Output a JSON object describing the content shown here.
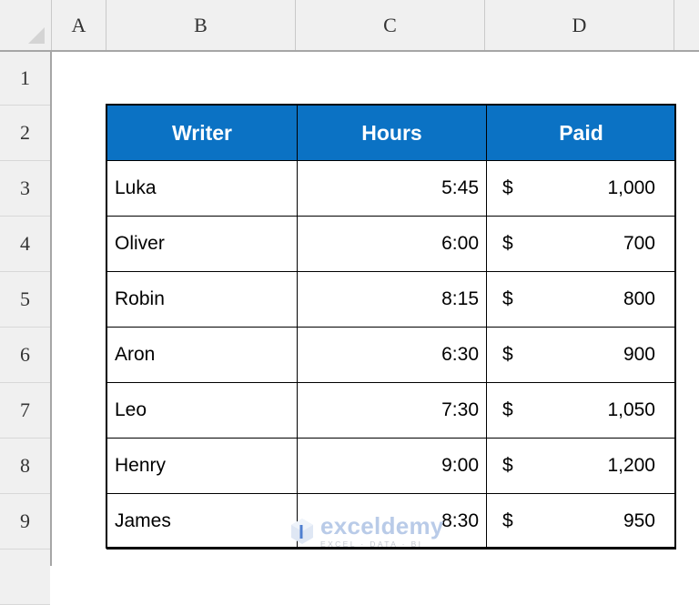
{
  "app": {
    "type": "spreadsheet",
    "accent_color": "#0B72C4",
    "header_text_color": "#FFFFFF",
    "grid_background": "#FFFFFF",
    "gutter_background": "#F0F0F0",
    "border_color": "#000000"
  },
  "grid": {
    "column_headers": [
      "A",
      "B",
      "C",
      "D"
    ],
    "row_headers": [
      "1",
      "2",
      "3",
      "4",
      "5",
      "6",
      "7",
      "8",
      "9"
    ],
    "select_all_corner": "select-all-triangle"
  },
  "table": {
    "columns": [
      {
        "key": "writer",
        "label": "Writer",
        "align": "left"
      },
      {
        "key": "hours",
        "label": "Hours",
        "align": "right"
      },
      {
        "key": "paid",
        "label": "Paid",
        "align": "right"
      }
    ],
    "rows": [
      {
        "writer": "Luka",
        "hours": "5:45",
        "paid_symbol": "$",
        "paid_amount": "1,000"
      },
      {
        "writer": "Oliver",
        "hours": "6:00",
        "paid_symbol": "$",
        "paid_amount": "700"
      },
      {
        "writer": "Robin",
        "hours": "8:15",
        "paid_symbol": "$",
        "paid_amount": "800"
      },
      {
        "writer": "Aron",
        "hours": "6:30",
        "paid_symbol": "$",
        "paid_amount": "900"
      },
      {
        "writer": "Leo",
        "hours": "7:30",
        "paid_symbol": "$",
        "paid_amount": "1,050"
      },
      {
        "writer": "Henry",
        "hours": "9:00",
        "paid_symbol": "$",
        "paid_amount": "1,200"
      },
      {
        "writer": "James",
        "hours": "8:30",
        "paid_symbol": "$",
        "paid_amount": "950"
      }
    ]
  },
  "watermark": {
    "name": "exceldemy",
    "tagline": "EXCEL · DATA · BI",
    "logo": "cube-logo-icon",
    "color": "#B9CBE8"
  }
}
